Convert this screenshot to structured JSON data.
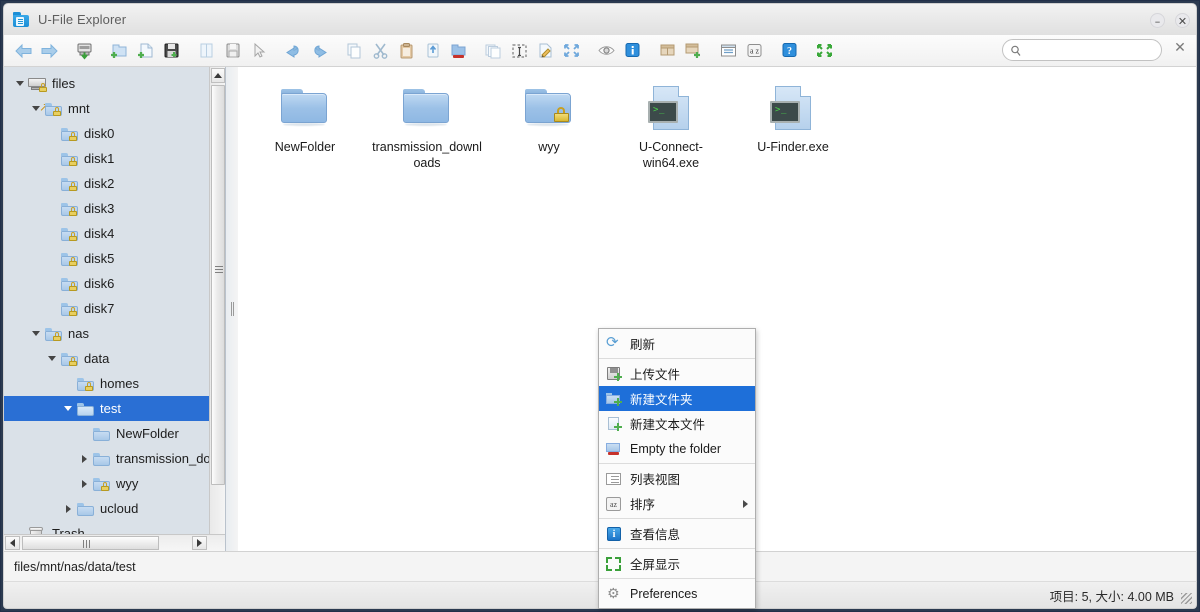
{
  "window": {
    "title": "U-File Explorer",
    "app_icon": "folder-app-icon",
    "minimize_label": "–",
    "close_label": "✕"
  },
  "toolbar": {
    "groups": [
      {
        "buttons": [
          {
            "name": "back-button",
            "icon": "arrow-left-icon"
          },
          {
            "name": "forward-button",
            "icon": "arrow-right-icon"
          }
        ]
      },
      {
        "buttons": [
          {
            "name": "download-button",
            "icon": "drive-download-icon"
          }
        ]
      },
      {
        "buttons": [
          {
            "name": "new-folder-button",
            "icon": "folder-add-icon"
          },
          {
            "name": "new-file-button",
            "icon": "file-add-icon"
          },
          {
            "name": "save-button",
            "icon": "floppy-save-icon"
          }
        ]
      },
      {
        "buttons": [
          {
            "name": "open-button",
            "icon": "open-book-icon"
          },
          {
            "name": "save-as-button",
            "icon": "floppy-icon"
          },
          {
            "name": "select-button",
            "icon": "cursor-arrow-icon"
          }
        ]
      },
      {
        "buttons": [
          {
            "name": "undo-button",
            "icon": "undo-arrow-icon"
          },
          {
            "name": "redo-button",
            "icon": "redo-arrow-icon"
          }
        ]
      },
      {
        "buttons": [
          {
            "name": "copy-button",
            "icon": "copy-icon"
          },
          {
            "name": "cut-button",
            "icon": "scissors-icon"
          },
          {
            "name": "paste-button",
            "icon": "clipboard-icon"
          },
          {
            "name": "paste-special-button",
            "icon": "clipboard-arrow-icon"
          },
          {
            "name": "delete-button",
            "icon": "delete-folder-icon"
          }
        ]
      },
      {
        "buttons": [
          {
            "name": "duplicate-button",
            "icon": "stack-icon"
          },
          {
            "name": "select-all-button",
            "icon": "marquee-select-icon"
          },
          {
            "name": "rename-button",
            "icon": "pencil-edit-icon"
          },
          {
            "name": "resize-button",
            "icon": "arrows-in-icon"
          }
        ]
      },
      {
        "buttons": [
          {
            "name": "preview-button",
            "icon": "eye-icon"
          },
          {
            "name": "info-button",
            "icon": "info-icon"
          }
        ]
      },
      {
        "buttons": [
          {
            "name": "archive-button",
            "icon": "archive-icon"
          },
          {
            "name": "archive-add-button",
            "icon": "archive-add-icon"
          }
        ]
      },
      {
        "buttons": [
          {
            "name": "list-view-button",
            "icon": "list-view-icon"
          },
          {
            "name": "sort-button",
            "icon": "sort-az-icon"
          }
        ]
      },
      {
        "buttons": [
          {
            "name": "help-button",
            "icon": "help-question-icon"
          }
        ]
      },
      {
        "buttons": [
          {
            "name": "fullscreen-button",
            "icon": "fullscreen-icon"
          }
        ]
      }
    ]
  },
  "search": {
    "value": "",
    "placeholder": "",
    "icon": "search-icon",
    "close_icon": "close-icon"
  },
  "sidebar": {
    "items": [
      {
        "label": "files",
        "depth": 0,
        "twisty": "down",
        "icon": "drive-icon",
        "selected": false
      },
      {
        "label": "mnt",
        "depth": 1,
        "twisty": "down",
        "icon": "folder-shortcut-lock-icon",
        "selected": false
      },
      {
        "label": "disk0",
        "depth": 2,
        "twisty": "none",
        "icon": "folder-lock-icon",
        "selected": false
      },
      {
        "label": "disk1",
        "depth": 2,
        "twisty": "none",
        "icon": "folder-lock-icon",
        "selected": false
      },
      {
        "label": "disk2",
        "depth": 2,
        "twisty": "none",
        "icon": "folder-lock-icon",
        "selected": false
      },
      {
        "label": "disk3",
        "depth": 2,
        "twisty": "none",
        "icon": "folder-lock-icon",
        "selected": false
      },
      {
        "label": "disk4",
        "depth": 2,
        "twisty": "none",
        "icon": "folder-lock-icon",
        "selected": false
      },
      {
        "label": "disk5",
        "depth": 2,
        "twisty": "none",
        "icon": "folder-lock-icon",
        "selected": false
      },
      {
        "label": "disk6",
        "depth": 2,
        "twisty": "none",
        "icon": "folder-lock-icon",
        "selected": false
      },
      {
        "label": "disk7",
        "depth": 2,
        "twisty": "none",
        "icon": "folder-lock-icon",
        "selected": false
      },
      {
        "label": "nas",
        "depth": 1,
        "twisty": "down",
        "icon": "folder-lock-icon",
        "selected": false
      },
      {
        "label": "data",
        "depth": 2,
        "twisty": "down",
        "icon": "folder-lock-icon",
        "selected": false
      },
      {
        "label": "homes",
        "depth": 3,
        "twisty": "none",
        "icon": "folder-lock-icon",
        "selected": false
      },
      {
        "label": "test",
        "depth": 3,
        "twisty": "down",
        "icon": "folder-open-icon",
        "selected": true
      },
      {
        "label": "NewFolder",
        "depth": 4,
        "twisty": "none",
        "icon": "folder-icon",
        "selected": false
      },
      {
        "label": "transmission_downl",
        "depth": 4,
        "twisty": "right",
        "icon": "folder-icon",
        "selected": false
      },
      {
        "label": "wyy",
        "depth": 4,
        "twisty": "right",
        "icon": "folder-lock-icon",
        "selected": false
      },
      {
        "label": "ucloud",
        "depth": 3,
        "twisty": "right",
        "icon": "folder-icon",
        "selected": false
      },
      {
        "label": "Trash",
        "depth": 0,
        "twisty": "none",
        "icon": "trash-icon",
        "selected": false
      }
    ]
  },
  "files": [
    {
      "name": "NewFolder",
      "type": "folder",
      "locked": false
    },
    {
      "name": "transmission_downloads",
      "type": "folder",
      "locked": false
    },
    {
      "name": "wyy",
      "type": "folder",
      "locked": true
    },
    {
      "name": "U-Connect-win64.exe",
      "type": "executable",
      "locked": false
    },
    {
      "name": "U-Finder.exe",
      "type": "executable",
      "locked": false
    }
  ],
  "context_menu": {
    "items": [
      {
        "label": "刷新",
        "icon": "refresh-icon",
        "highlighted": false,
        "submenu": false,
        "separator_after": true
      },
      {
        "label": "上传文件",
        "icon": "upload-file-icon",
        "highlighted": false,
        "submenu": false,
        "separator_after": false
      },
      {
        "label": "新建文件夹",
        "icon": "new-folder-icon",
        "highlighted": true,
        "submenu": false,
        "separator_after": false
      },
      {
        "label": "新建文本文件",
        "icon": "new-text-file-icon",
        "highlighted": false,
        "submenu": false,
        "separator_after": false
      },
      {
        "label": "Empty the folder",
        "icon": "empty-folder-icon",
        "highlighted": false,
        "submenu": false,
        "separator_after": true
      },
      {
        "label": "列表视图",
        "icon": "list-view-icon",
        "highlighted": false,
        "submenu": false,
        "separator_after": false
      },
      {
        "label": "排序",
        "icon": "sort-az-icon",
        "highlighted": false,
        "submenu": true,
        "separator_after": true
      },
      {
        "label": "查看信息",
        "icon": "info-icon",
        "highlighted": false,
        "submenu": false,
        "separator_after": true
      },
      {
        "label": "全屏显示",
        "icon": "fullscreen-icon",
        "highlighted": false,
        "submenu": false,
        "separator_after": true
      },
      {
        "label": "Preferences",
        "icon": "gear-icon",
        "highlighted": false,
        "submenu": false,
        "separator_after": false
      }
    ]
  },
  "pathbar": {
    "path": "files/mnt/nas/data/test"
  },
  "statusbar": {
    "info": "项目: 5, 大小: 4.00 MB"
  },
  "colors": {
    "selection_blue": "#2a6fd4",
    "menu_highlight": "#1e6fd9",
    "sidebar_bg": "#dae1e8",
    "window_frame": "#2b3a50"
  }
}
